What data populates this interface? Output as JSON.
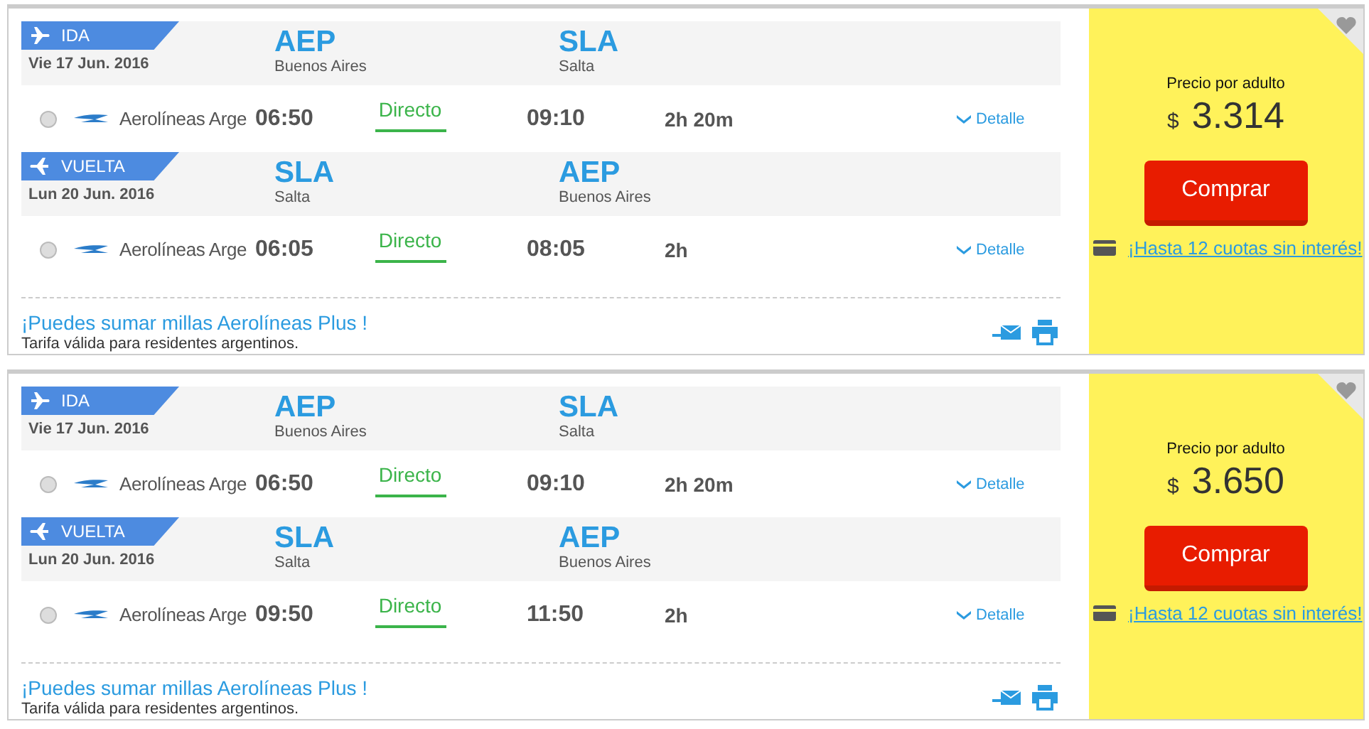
{
  "results": [
    {
      "legs": [
        {
          "kind": "ida",
          "label": "IDA",
          "date": "Vie 17 Jun. 2016",
          "origin": {
            "code": "AEP",
            "city": "Buenos Aires"
          },
          "destination": {
            "code": "SLA",
            "city": "Salta"
          },
          "flight": {
            "selected": false,
            "airline": "Aerolíneas Arge",
            "departure": "06:50",
            "stops": "Directo",
            "arrival": "09:10",
            "duration": "2h 20m",
            "detail": "Detalle"
          }
        },
        {
          "kind": "vuelta",
          "label": "VUELTA",
          "date": "Lun 20 Jun. 2016",
          "origin": {
            "code": "SLA",
            "city": "Salta"
          },
          "destination": {
            "code": "AEP",
            "city": "Buenos Aires"
          },
          "flight": {
            "selected": false,
            "airline": "Aerolíneas Arge",
            "departure": "06:05",
            "stops": "Directo",
            "arrival": "08:05",
            "duration": "2h",
            "detail": "Detalle"
          }
        }
      ],
      "miles": "¡Puedes sumar millas Aerolíneas Plus !",
      "fare_note": "Tarifa válida para residentes argentinos.",
      "price": {
        "label": "Precio por adulto",
        "currency": "$",
        "amount": "3.314"
      },
      "buy_button": "Comprar",
      "installments": "¡Hasta 12 cuotas sin interés!"
    },
    {
      "legs": [
        {
          "kind": "ida",
          "label": "IDA",
          "date": "Vie 17 Jun. 2016",
          "origin": {
            "code": "AEP",
            "city": "Buenos Aires"
          },
          "destination": {
            "code": "SLA",
            "city": "Salta"
          },
          "flight": {
            "selected": false,
            "airline": "Aerolíneas Arge",
            "departure": "06:50",
            "stops": "Directo",
            "arrival": "09:10",
            "duration": "2h 20m",
            "detail": "Detalle"
          }
        },
        {
          "kind": "vuelta",
          "label": "VUELTA",
          "date": "Lun 20 Jun. 2016",
          "origin": {
            "code": "SLA",
            "city": "Salta"
          },
          "destination": {
            "code": "AEP",
            "city": "Buenos Aires"
          },
          "flight": {
            "selected": false,
            "airline": "Aerolíneas Arge",
            "departure": "09:50",
            "stops": "Directo",
            "arrival": "11:50",
            "duration": "2h",
            "detail": "Detalle"
          }
        }
      ],
      "miles": "¡Puedes sumar millas Aerolíneas Plus !",
      "fare_note": "Tarifa válida para residentes argentinos.",
      "price": {
        "label": "Precio por adulto",
        "currency": "$",
        "amount": "3.650"
      },
      "buy_button": "Comprar",
      "installments": "¡Hasta 12 cuotas sin interés!"
    }
  ]
}
